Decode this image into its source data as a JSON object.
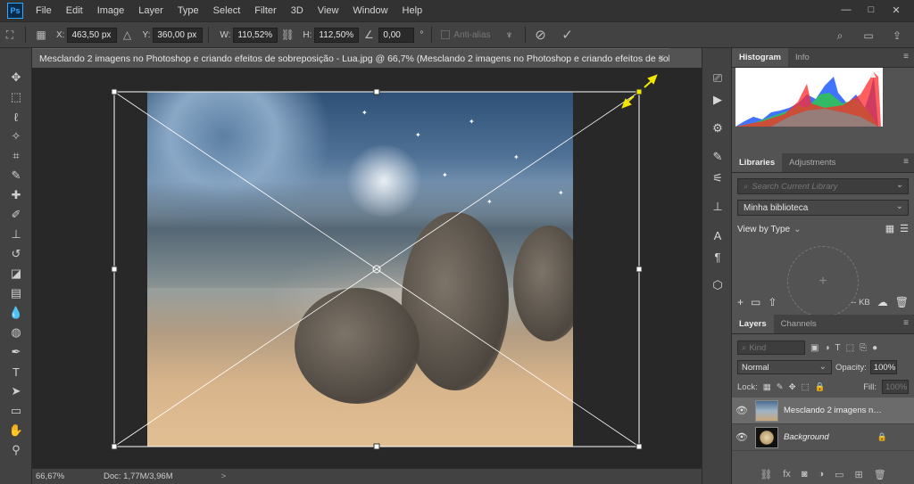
{
  "app": {
    "logo": "Ps"
  },
  "menu": [
    "File",
    "Edit",
    "Image",
    "Layer",
    "Type",
    "Select",
    "Filter",
    "3D",
    "View",
    "Window",
    "Help"
  ],
  "window_controls": {
    "minimize": "—",
    "restore": "□",
    "close": "✕"
  },
  "options": {
    "x_label": "X:",
    "x_value": "463,50 px",
    "y_label": "Y:",
    "y_value": "360,00 px",
    "w_label": "W:",
    "w_value": "110,52%",
    "h_label": "H:",
    "h_value": "112,50%",
    "angle_value": "0,00",
    "angle_unit": "°",
    "antialias_label": "Anti-alias"
  },
  "document": {
    "tab_title": "Mesclando 2 imagens no Photoshop e criando efeitos de sobreposição - Lua.jpg @ 66,7% (Mesclando 2 imagens no Photoshop e criando efeitos de sobrepo...",
    "close": "×"
  },
  "status": {
    "zoom": "66,67%",
    "doc": "Doc: 1,77M/3,96M",
    "arrow": ">"
  },
  "histogram_panel": {
    "tabs": [
      "Histogram",
      "Info"
    ]
  },
  "libraries_panel": {
    "tabs": [
      "Libraries",
      "Adjustments"
    ],
    "search_placeholder": "Search Current Library",
    "library_name": "Minha biblioteca",
    "view_by": "View by Type",
    "size": "-- KB"
  },
  "layers_panel": {
    "tabs": [
      "Layers",
      "Channels"
    ],
    "kind": "Kind",
    "blend_mode": "Normal",
    "opacity_label": "Opacity:",
    "opacity_value": "100%",
    "lock_label": "Lock:",
    "fill_label": "Fill:",
    "fill_value": "100%",
    "layers": [
      {
        "name": "Mesclando 2 imagens no P...",
        "selected": true
      },
      {
        "name": "Background",
        "selected": false
      }
    ]
  },
  "colors": {
    "accent": "#31a8ff",
    "handle_yellow": "#f2e600",
    "panel_bg": "#535353",
    "canvas_bg": "#282828"
  }
}
